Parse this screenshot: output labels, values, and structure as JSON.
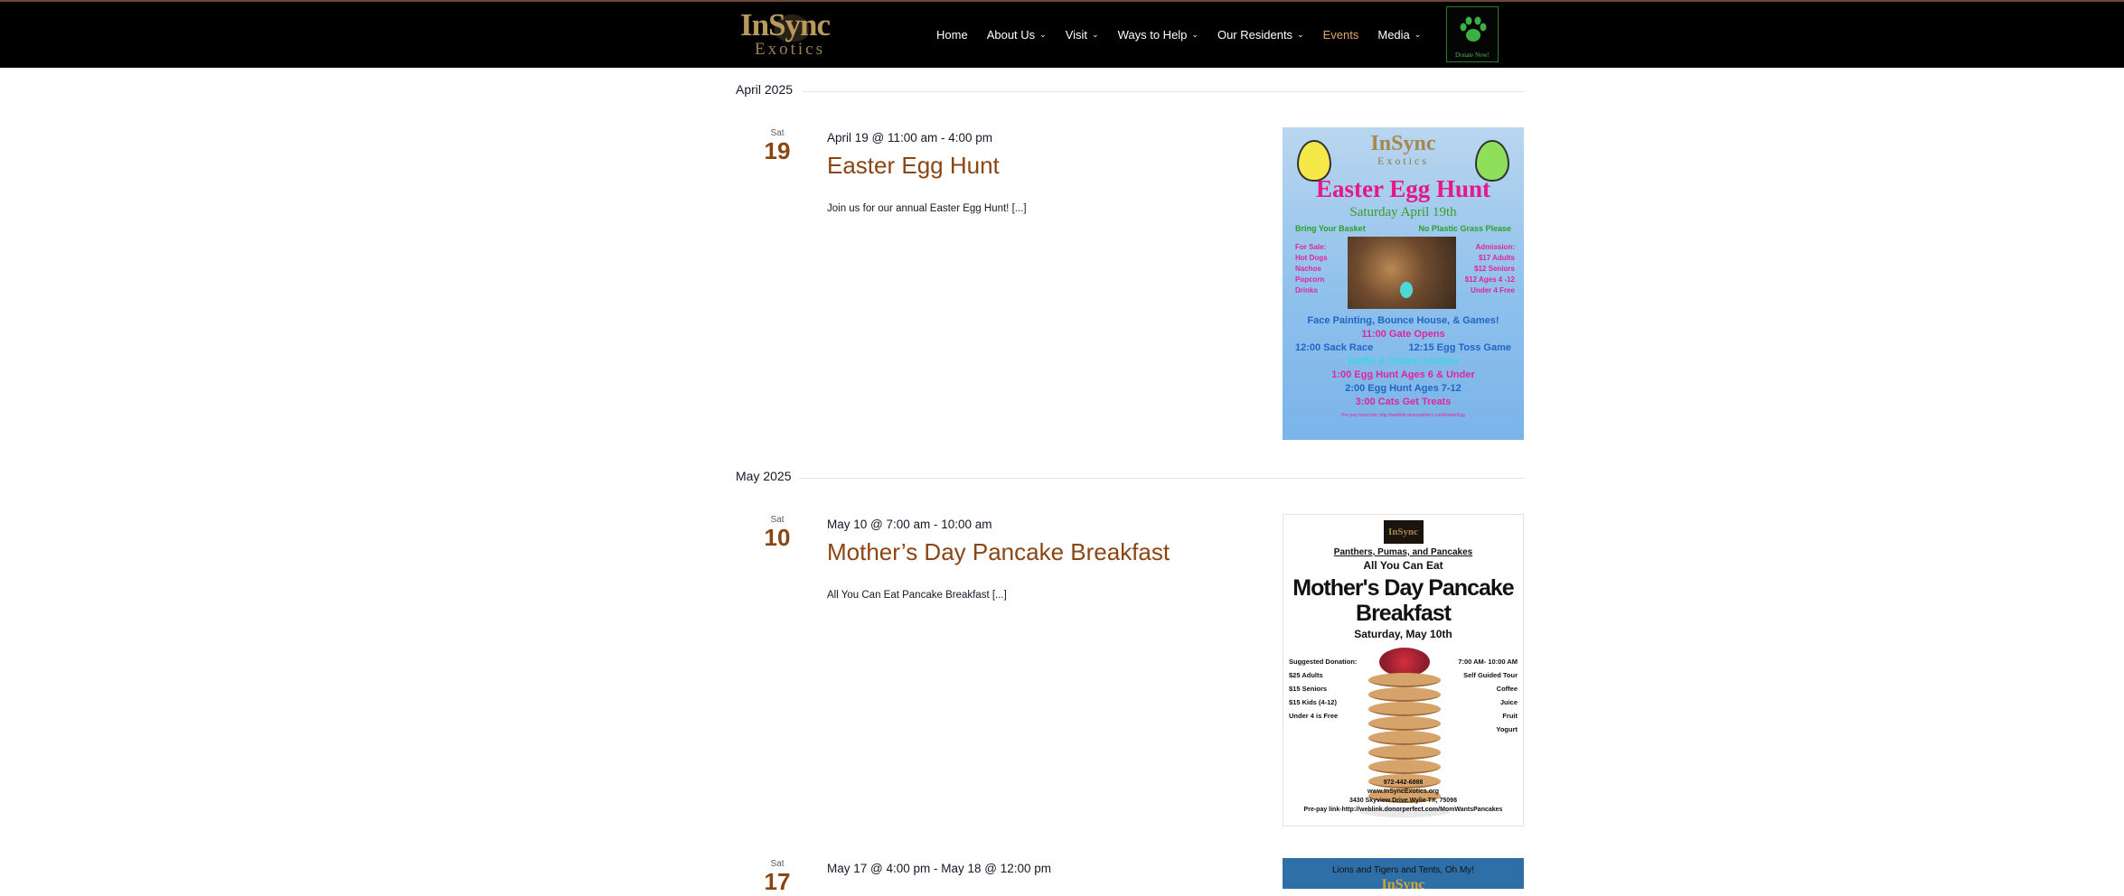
{
  "header": {
    "logo": {
      "line1": "InSync",
      "line2": "Exotics"
    },
    "nav": [
      {
        "label": "Home",
        "has_menu": false,
        "active": false
      },
      {
        "label": "About Us",
        "has_menu": true,
        "active": false
      },
      {
        "label": "Visit",
        "has_menu": true,
        "active": false
      },
      {
        "label": "Ways to Help",
        "has_menu": true,
        "active": false
      },
      {
        "label": "Our Residents",
        "has_menu": true,
        "active": false
      },
      {
        "label": "Events",
        "has_menu": false,
        "active": true
      },
      {
        "label": "Media",
        "has_menu": true,
        "active": false
      }
    ],
    "donate": {
      "label": "Donate Now!",
      "icon": "paw-icon"
    }
  },
  "months": [
    {
      "label": "April 2025"
    },
    {
      "label": "May 2025"
    }
  ],
  "events": [
    {
      "dow": "Sat",
      "day": "19",
      "when_start": "April 19 @ 11:00 am",
      "when_sep": " - ",
      "when_end": "4:00 pm",
      "title": "Easter Egg Hunt",
      "description": "Join us for our annual Easter Egg Hunt! [...]"
    },
    {
      "dow": "Sat",
      "day": "10",
      "when_start": "May 10 @ 7:00 am",
      "when_sep": " - ",
      "when_end": "10:00 am",
      "title": "Mother’s Day Pancake Breakfast",
      "description": "All You Can Eat Pancake Breakfast [...]"
    },
    {
      "dow": "Sat",
      "day": "17",
      "when_start": "May 17 @ 4:00 pm",
      "when_sep": " - ",
      "when_end": "May 18 @ 12:00 pm"
    }
  ],
  "posters": {
    "easter": {
      "logo": "InSync",
      "logo_sub": "Exotics",
      "title": "Easter Egg Hunt",
      "date": "Saturday April 19th",
      "row1_left": "Bring Your Basket",
      "row1_right": "No Plastic Grass Please",
      "left_lines": [
        "For Sale:",
        "Hot Dogs",
        "Nachos",
        "Popcorn",
        "Drinks"
      ],
      "right_lines": [
        "Admission:",
        "$17 Adults",
        "$12 Seniors",
        "$12 Ages 4 -12",
        "Under 4 Free"
      ],
      "line_games": "Face Painting, Bounce House, & Games!",
      "line_gate": "11:00 Gate Opens",
      "line_sack": "12:00 Sack Race",
      "line_toss": "12:15 Egg Toss Game",
      "line_raffle": "Raffle & Online Auction",
      "line_hunt1": "1:00    Egg Hunt Ages 6 & Under",
      "line_hunt2": "2:00    Egg Hunt  Ages 7-12",
      "line_cats": "3:00    Cats Get Treats",
      "foot": "Pre-pay ticket link: http://weblink.donorperfect.com/EasterEgg"
    },
    "pancake": {
      "logo": "InSync",
      "top": "Panthers, Pumas, and Pancakes",
      "aye": "All You Can Eat",
      "title": "Mother's Day Pancake Breakfast",
      "sat": "Saturday, May 10th",
      "left_lines": [
        "Suggested Donation:",
        "$25 Adults",
        "$15 Seniors",
        "$15 Kids (4-12)",
        "Under 4 is Free"
      ],
      "right_lines": [
        "7:00 AM- 10:00 AM",
        "Self Guided Tour",
        "Coffee",
        "Juice",
        "Fruit",
        "Yogurt"
      ],
      "contact": [
        "972-442-6888",
        "www.InSyncExotics.org",
        "3430 Skyview Drive Wylie TX, 75098",
        "Pre-pay link-http://weblink.donorperfect.com/MomWantsPancakes"
      ]
    },
    "tents": {
      "head": "Lions and Tigers and Tents, Oh My!",
      "logo": "InSync"
    }
  }
}
